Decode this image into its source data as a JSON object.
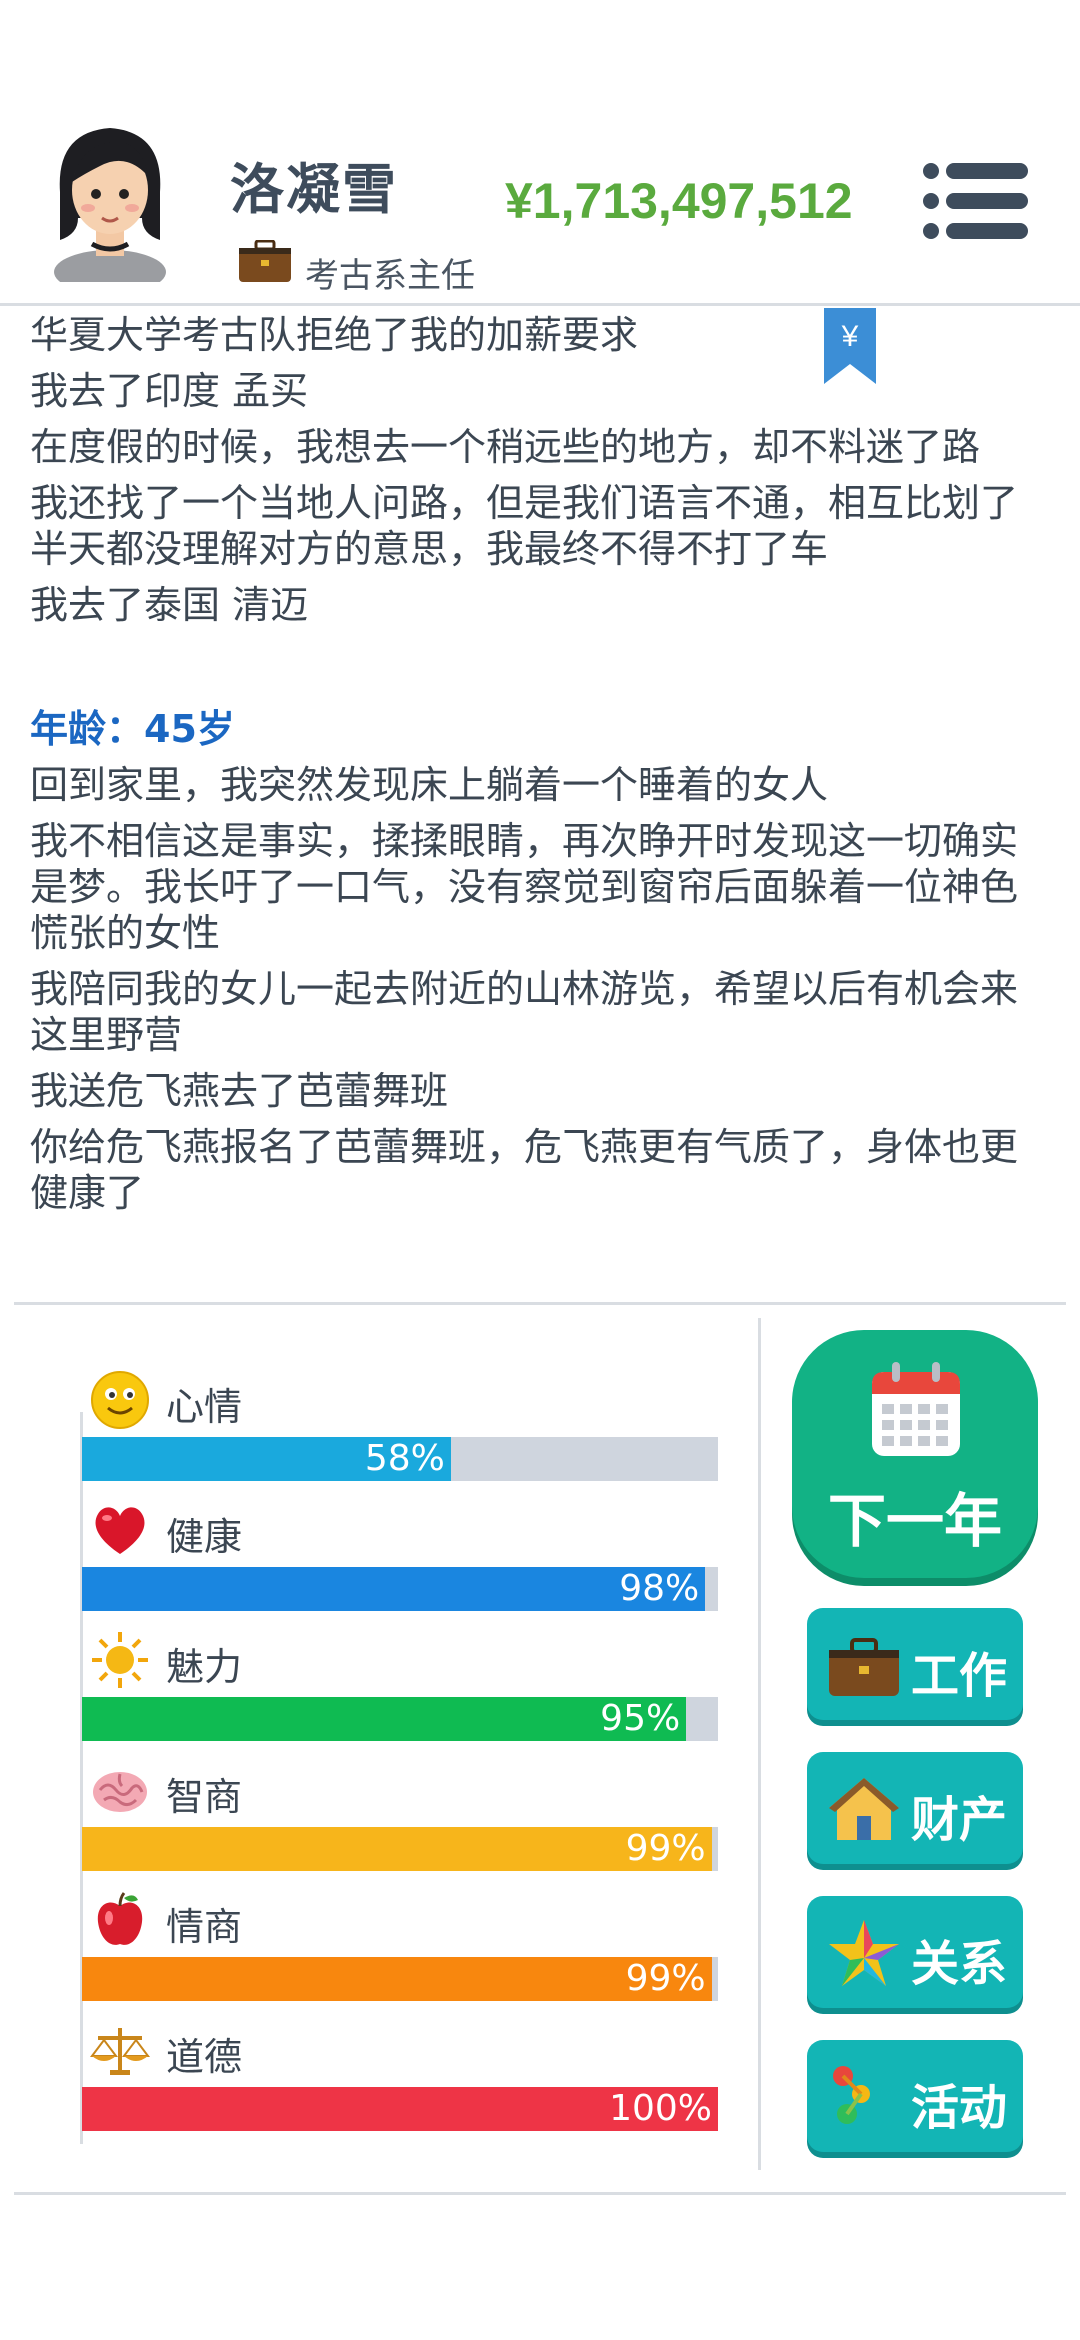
{
  "header": {
    "name": "洛凝雪",
    "job_title": "考古系主任",
    "money": "¥1,713,497,512"
  },
  "log": {
    "lines_before_age": [
      "华夏大学考古队拒绝了我的加薪要求",
      "我去了印度 孟买",
      "在度假的时候，我想去一个稍远些的地方，却不料迷了路",
      "我还找了一个当地人问路，但是我们语言不通，相互比划了半天都没理解对方的意思，我最终不得不打了车",
      "我去了泰国 清迈"
    ],
    "age_label": "年龄：45岁",
    "lines_after_age": [
      "回到家里，我突然发现床上躺着一个睡着的女人",
      "我不相信这是事实，揉揉眼睛，再次睁开时发现这一切确实是梦。我长吁了一口气，没有察觉到窗帘后面躲着一位神色慌张的女性",
      "我陪同我的女儿一起去附近的山林游览，希望以后有机会来这里野营",
      "我送危飞燕去了芭蕾舞班",
      "你给危飞燕报名了芭蕾舞班，危飞燕更有气质了，身体也更健康了"
    ],
    "bookmark_symbol": "¥"
  },
  "stats": [
    {
      "label": "心情",
      "icon": "smiley-icon",
      "value": 58,
      "text": "58%",
      "color": "#1aa9dd"
    },
    {
      "label": "健康",
      "icon": "heart-icon",
      "value": 98,
      "text": "98%",
      "color": "#1a86e0"
    },
    {
      "label": "魅力",
      "icon": "sun-icon",
      "value": 95,
      "text": "95%",
      "color": "#0fbb52"
    },
    {
      "label": "智商",
      "icon": "brain-icon",
      "value": 99,
      "text": "99%",
      "color": "#f7b51b"
    },
    {
      "label": "情商",
      "icon": "apple-icon",
      "value": 99,
      "text": "99%",
      "color": "#f8870e"
    },
    {
      "label": "道德",
      "icon": "scales-icon",
      "value": 100,
      "text": "100%",
      "color": "#ee3446"
    }
  ],
  "buttons": {
    "next_year": "下一年",
    "work": "工作",
    "property": "财产",
    "relations": "关系",
    "activities": "活动"
  },
  "colors": {
    "money": "#5aaa3e",
    "age": "#1b67c2",
    "next_button": "#12b285",
    "side_button": "#13b5b5"
  }
}
